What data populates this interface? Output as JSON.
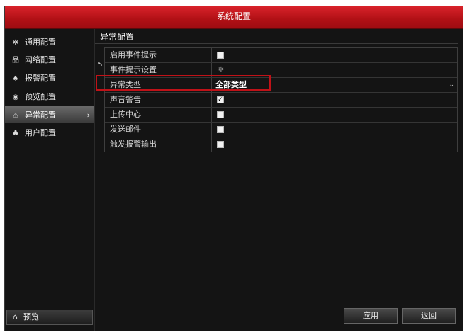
{
  "window": {
    "title": "系统配置"
  },
  "sidebar": {
    "items": [
      {
        "label": "通用配置",
        "icon": "gear-icon"
      },
      {
        "label": "网络配置",
        "icon": "network-icon"
      },
      {
        "label": "报警配置",
        "icon": "alarm-icon"
      },
      {
        "label": "预览配置",
        "icon": "eye-icon"
      },
      {
        "label": "异常配置",
        "icon": "warning-icon",
        "active": true
      },
      {
        "label": "用户配置",
        "icon": "users-icon"
      }
    ],
    "preview_label": "预览"
  },
  "section": {
    "title": "异常配置"
  },
  "settings": {
    "rows": [
      {
        "label": "启用事件提示",
        "type": "checkbox",
        "checked": false
      },
      {
        "label": "事件提示设置",
        "type": "gear"
      },
      {
        "label": "异常类型",
        "type": "select",
        "value": "全部类型"
      },
      {
        "label": "声音警告",
        "type": "checkbox",
        "checked": true
      },
      {
        "label": "上传中心",
        "type": "checkbox",
        "checked": false
      },
      {
        "label": "发送邮件",
        "type": "checkbox",
        "checked": false
      },
      {
        "label": "触发报警输出",
        "type": "checkbox",
        "checked": false
      }
    ]
  },
  "footer": {
    "apply_label": "应用",
    "back_label": "返回"
  },
  "colors": {
    "title_bar": "#c0141a",
    "highlight_box": "#c01218",
    "section_underline": "#e0d000"
  }
}
